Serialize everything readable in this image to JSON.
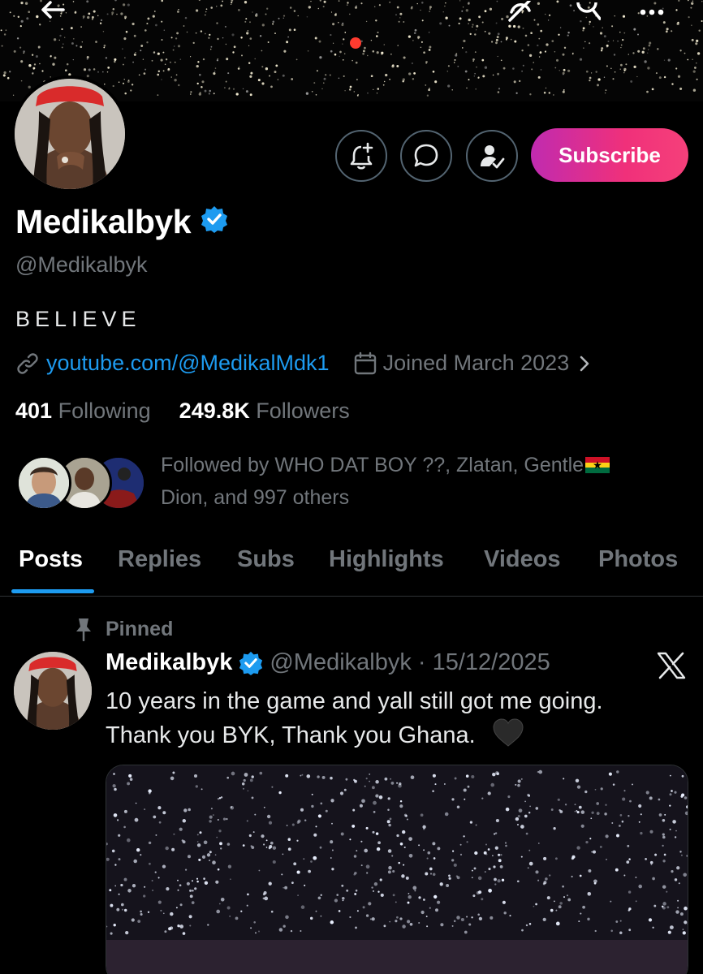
{
  "profile": {
    "display_name": "Medikalbyk",
    "handle": "@Medikalbyk",
    "bio": "BELIEVE",
    "website": "youtube.com/@MedikalMdk1",
    "joined": "Joined March 2023",
    "following_count": "401",
    "following_label": "Following",
    "followers_count": "249.8K",
    "followers_label": "Followers",
    "followed_by_line1": "Followed by WHO DAT BOY ??, Zlatan, Gentle",
    "followed_by_line2": "Dion, and 997 others"
  },
  "actions": {
    "subscribe_label": "Subscribe"
  },
  "tabs": [
    {
      "label": "Posts"
    },
    {
      "label": "Replies"
    },
    {
      "label": "Subs"
    },
    {
      "label": "Highlights"
    },
    {
      "label": "Videos"
    },
    {
      "label": "Photos"
    }
  ],
  "post": {
    "pinned_label": "Pinned",
    "author_name": "Medikalbyk",
    "author_handle_date": "@Medikalbyk · 15/12/2025",
    "text_line1": "10 years in the game and yall still got me going.",
    "text_line2": "Thank you BYK, Thank you Ghana."
  },
  "colors": {
    "background": "#000000",
    "accent_blue": "#1d9bf0",
    "muted_text": "#71767b",
    "subscribe_gradient_start": "#c02bb0",
    "subscribe_gradient_end": "#f5407a"
  },
  "icons": [
    "back-arrow-icon",
    "hide-icon",
    "search-icon",
    "more-icon",
    "notification-plus-icon",
    "message-icon",
    "follow-check-icon",
    "verified-icon",
    "link-icon",
    "calendar-icon",
    "chevron-right-icon",
    "pin-icon",
    "x-logo-icon",
    "black-heart-icon",
    "ghana-flag-icon"
  ]
}
